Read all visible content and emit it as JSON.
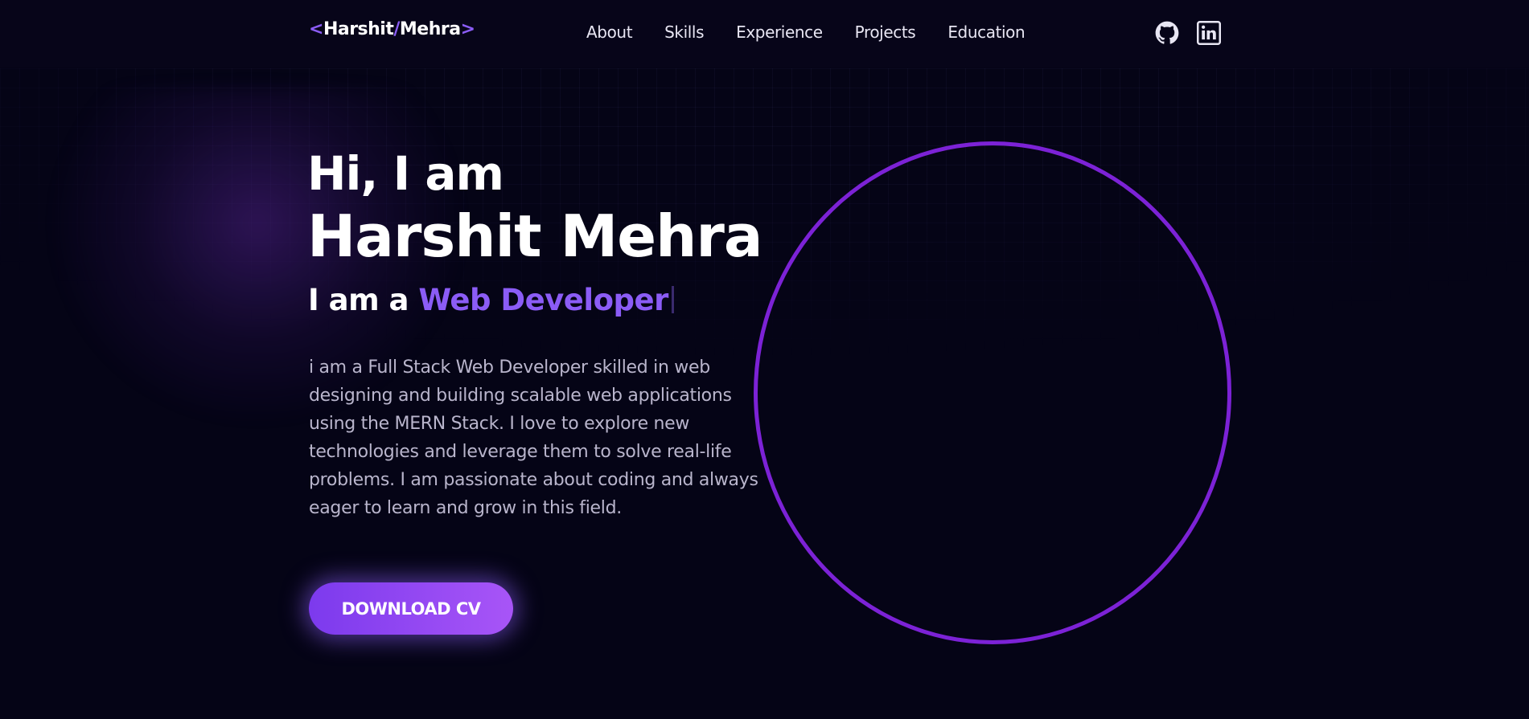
{
  "header": {
    "logo": {
      "open_bracket": "<",
      "first": "Harshit",
      "slash": "/",
      "last": "Mehra",
      "close_bracket": ">"
    },
    "nav": [
      {
        "label": "About"
      },
      {
        "label": "Skills"
      },
      {
        "label": "Experience"
      },
      {
        "label": "Projects"
      },
      {
        "label": "Education"
      }
    ],
    "social": [
      {
        "icon": "github-icon"
      },
      {
        "icon": "linkedin-icon"
      }
    ]
  },
  "hero": {
    "greeting": "Hi, I am",
    "name": "Harshit Mehra",
    "role_prefix": "I am a",
    "role_text": "Web Developer",
    "bio": "i am a Full Stack Web Developer skilled in web designing and building scalable web applications using the MERN Stack. I love to explore new technologies and leverage them to solve real-life problems. I am passionate about coding and always eager to learn and grow in this field.",
    "cta_label": "DOWNLOAD CV"
  },
  "colors": {
    "background": "#050416",
    "accent": "#8b5cf6",
    "ring": "#7c22d6",
    "text_muted": "#b9b5cc"
  }
}
